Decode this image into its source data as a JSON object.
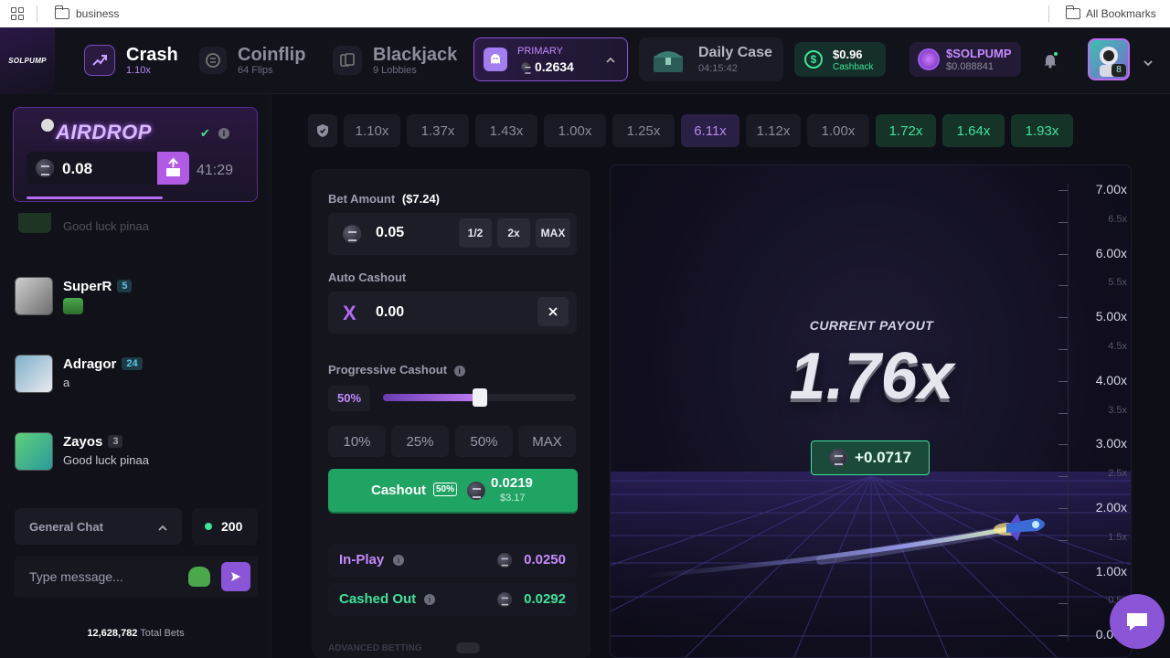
{
  "bookmarks": {
    "folder1": "business",
    "all": "All Bookmarks"
  },
  "brand": {
    "logo_text": "SOLPUMP"
  },
  "nav": {
    "crash": {
      "title": "Crash",
      "sub": "1.10x"
    },
    "coinflip": {
      "title": "Coinflip",
      "sub": "64 Flips"
    },
    "blackjack": {
      "title": "Blackjack",
      "sub": "9 Lobbies"
    },
    "primary": {
      "label": "PRIMARY",
      "balance": "0.2634"
    },
    "daily_case": {
      "title": "Daily Case",
      "timer": "04:15:42"
    },
    "cashback": {
      "amount": "$0.96",
      "label": "Cashback"
    },
    "solpump_token": {
      "name": "$SOLPUMP",
      "amount": "$0.088841"
    },
    "avatar_badge": "8"
  },
  "airdrop": {
    "title": "AIRDROP",
    "amount": "0.08",
    "timer": "41:29",
    "progress": 0.62
  },
  "chat": {
    "partial_text": "Good luck pinaa",
    "messages": [
      {
        "name": "SuperR",
        "level": "5",
        "text": ""
      },
      {
        "name": "Adragor",
        "level": "24",
        "text": "a"
      },
      {
        "name": "Zayos",
        "level": "3",
        "text": "Good luck pinaa"
      }
    ],
    "channel": "General Chat",
    "online": "200",
    "placeholder": "Type message...",
    "total_bets_value": "12,628,782",
    "total_bets_label": "Total Bets"
  },
  "history": [
    "1.10x",
    "1.37x",
    "1.43x",
    "1.00x",
    "1.25x",
    "6.11x",
    "1.12x",
    "1.00x",
    "1.72x",
    "1.64x",
    "1.93x"
  ],
  "bet": {
    "amount_label": "Bet Amount",
    "amount_usd": "($7.24)",
    "amount": "0.05",
    "half": "1/2",
    "double": "2x",
    "max": "MAX",
    "auto_label": "Auto Cashout",
    "auto_value": "0.00",
    "progressive_label": "Progressive Cashout",
    "progressive_pct": "50%",
    "progressive_value": 0.5,
    "pct_buttons": [
      "10%",
      "25%",
      "50%",
      "MAX"
    ],
    "cashout_label": "Cashout",
    "cashout_pct": "50%",
    "cashout_amount": "0.0219",
    "cashout_usd": "$3.17",
    "inplay_label": "In-Play",
    "inplay_value": "0.0250",
    "cashedout_label": "Cashed Out",
    "cashedout_value": "0.0292",
    "advanced_label": "ADVANCED BETTING"
  },
  "game": {
    "payout_title": "CURRENT PAYOUT",
    "payout": "1.76x",
    "profit": "+0.0717",
    "axis": [
      "7.00x",
      "6.5x",
      "6.00x",
      "5.5x",
      "5.00x",
      "4.5x",
      "4.00x",
      "3.5x",
      "3.00x",
      "2.5x",
      "2.00x",
      "1.5x",
      "1.00x",
      "0.5x",
      "0.00x"
    ]
  },
  "colors": {
    "accent": "#8b4fd9",
    "green": "#3fe39a",
    "cashout": "#1fa464"
  }
}
